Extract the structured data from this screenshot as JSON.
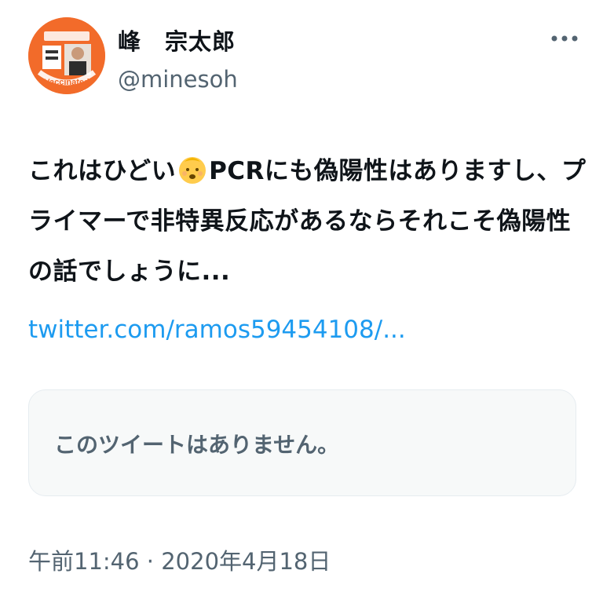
{
  "author": {
    "display_name": "峰　宗太郎",
    "handle": "@minesoh",
    "avatar_text": "Vaccinated"
  },
  "tweet": {
    "lines": [
      "これはひどい",
      "PCRにも偽陽性はありますし、プ",
      "ライマーで非特異反応があるならそれこそ偽陽性",
      "の話でしょうに..."
    ],
    "emoji": "baby-face-emoji",
    "link": "twitter.com/ramos59454108/...",
    "quoted_unavailable": "このツイートはありません。",
    "timestamp": "午前11:46 · 2020年4月18日"
  },
  "colors": {
    "link": "#1d9bf0",
    "secondary": "#536471",
    "avatar_bg": "#f26b2a"
  },
  "icons": {
    "more": "more-horizontal-icon"
  }
}
